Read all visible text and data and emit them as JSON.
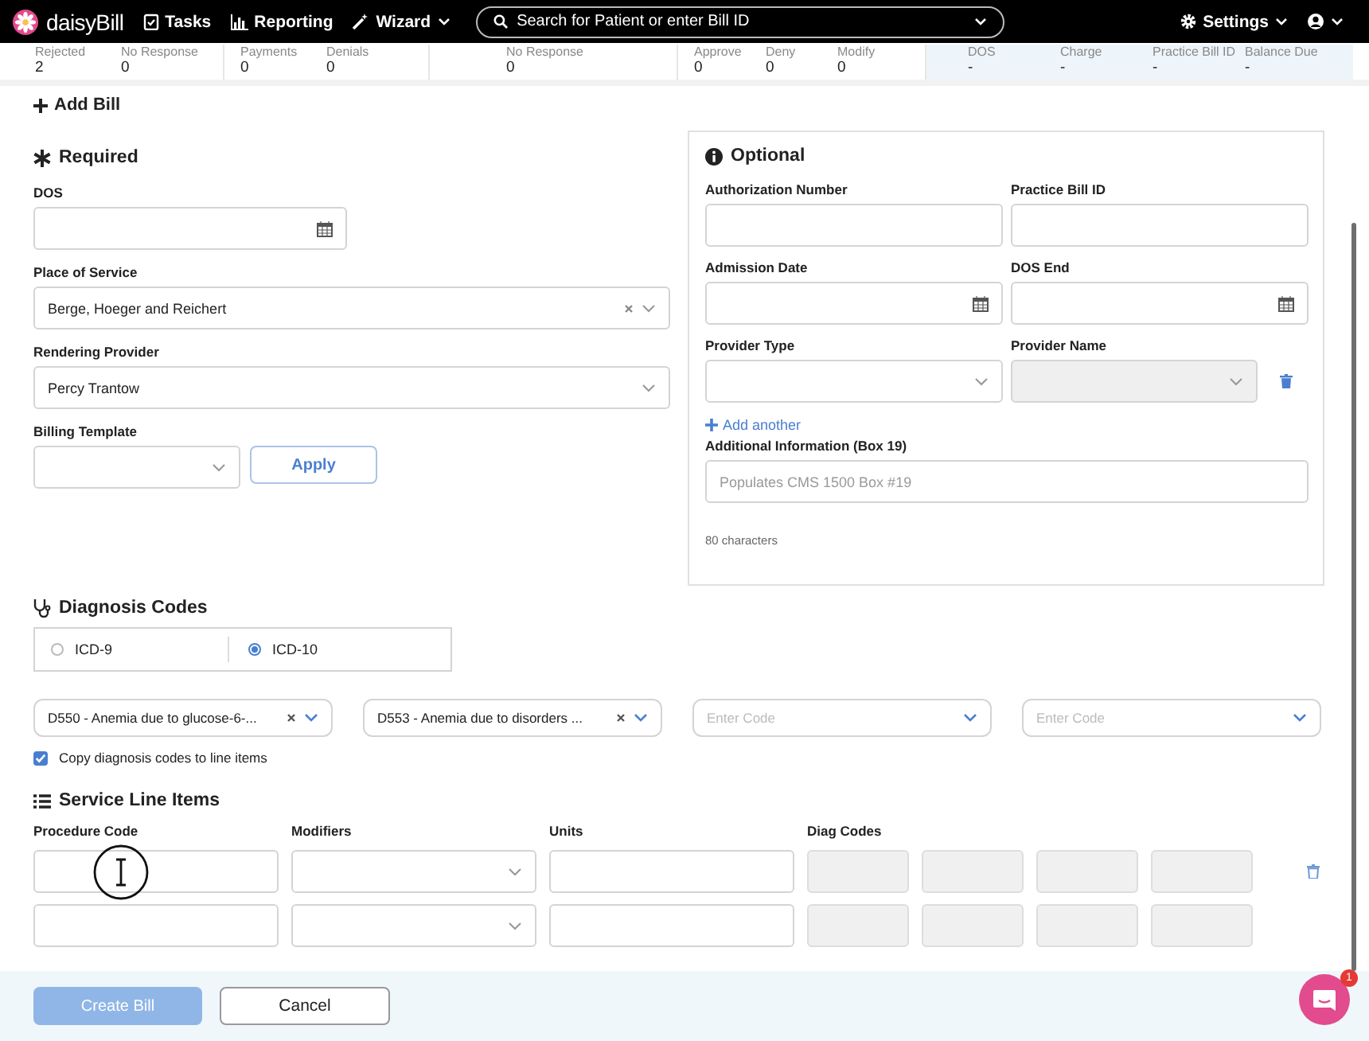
{
  "nav": {
    "logo": "daisyBill",
    "items": [
      {
        "label": "Tasks",
        "kind": "tasks"
      },
      {
        "label": "Reporting",
        "kind": "chart"
      },
      {
        "label": "Wizard",
        "kind": "wand"
      }
    ],
    "search": {
      "placeholder": "Search for Patient or enter Bill ID"
    },
    "settings": "Settings"
  },
  "stats": [
    {
      "kind": "plain",
      "items": [
        {
          "label": "Rejected",
          "value": "2"
        },
        {
          "label": "No Response",
          "value": "0"
        }
      ]
    },
    {
      "kind": "plain",
      "items": [
        {
          "label": "Payments",
          "value": "0"
        },
        {
          "label": "Denials",
          "value": "0"
        }
      ]
    },
    {
      "kind": "plain",
      "items": [
        {
          "label": "No Response",
          "value": "0"
        }
      ]
    },
    {
      "kind": "plain",
      "items": [
        {
          "label": "Approve",
          "value": "0"
        },
        {
          "label": "Deny",
          "value": "0"
        },
        {
          "label": "Modify",
          "value": "0"
        }
      ]
    },
    {
      "kind": "highlight",
      "items": [
        {
          "label": "DOS",
          "value": "-"
        },
        {
          "label": "Charge",
          "value": "-"
        },
        {
          "label": "Practice Bill ID",
          "value": "-"
        },
        {
          "label": "Balance Due",
          "value": "-"
        }
      ]
    }
  ],
  "heading": "Add Bill",
  "required": {
    "title": "Required",
    "fields": [
      {
        "label": "DOS",
        "kind": "date"
      },
      {
        "label": "Place of Service",
        "kind": "select",
        "value": "Berge, Hoeger and Reichert",
        "clearable": true
      },
      {
        "label": "Rendering Provider",
        "kind": "select",
        "value": "Percy Trantow",
        "clearable": false
      }
    ],
    "template": {
      "label": "Billing Template",
      "button": "Apply"
    }
  },
  "optional": {
    "title": "Optional",
    "rows": [
      [
        {
          "label": "Authorization Number",
          "kind": "text"
        },
        {
          "label": "Practice Bill ID",
          "kind": "text"
        }
      ],
      [
        {
          "label": "Admission Date",
          "kind": "date"
        },
        {
          "label": "DOS End",
          "kind": "date"
        }
      ],
      [
        {
          "label": "Provider Type",
          "kind": "select",
          "disabled": false
        },
        {
          "label": "Provider Name",
          "kind": "select",
          "disabled": true
        }
      ]
    ],
    "add_another": "Add another",
    "info": {
      "label": "Additional Information (Box 19)",
      "placeholder": "Populates CMS 1500 Box #19",
      "counter": "80 characters"
    }
  },
  "diagnosis": {
    "title": "Diagnosis Codes",
    "code_sets": [
      {
        "label": "ICD-9",
        "selected": false
      },
      {
        "label": "ICD-10",
        "selected": true
      }
    ],
    "codes": [
      {
        "value": "D550 - Anemia due to glucose-6-...",
        "clearable": true
      },
      {
        "value": "D553 - Anemia due to disorders ...",
        "clearable": true
      },
      {
        "placeholder": "Enter Code",
        "clearable": false
      },
      {
        "placeholder": "Enter Code",
        "clearable": false
      }
    ],
    "copy": {
      "label": "Copy diagnosis codes to line items",
      "checked": true
    }
  },
  "service_lines": {
    "title": "Service Line Items",
    "columns": [
      "Procedure Code",
      "Modifiers",
      "Units",
      "Diag Codes"
    ],
    "rows": [
      {
        "deletable": true
      },
      {
        "deletable": false
      }
    ]
  },
  "footer": {
    "create": {
      "label": "Create Bill",
      "disabled": true
    },
    "cancel": "Cancel",
    "chat_badge": "1"
  }
}
